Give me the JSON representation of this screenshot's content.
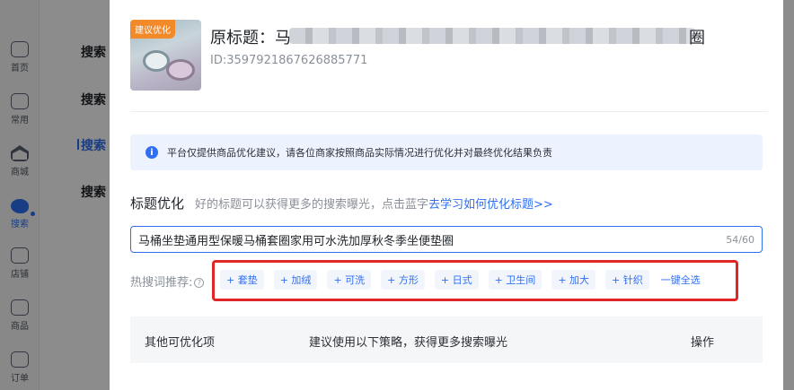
{
  "sidebar": {
    "items": [
      {
        "label": "首页",
        "icon": "home-icon"
      },
      {
        "label": "常用",
        "icon": "star-icon"
      },
      {
        "label": "商城",
        "icon": "shop-icon"
      },
      {
        "label": "搜索",
        "icon": "search-icon",
        "active": true
      },
      {
        "label": "店铺",
        "icon": "store-icon"
      },
      {
        "label": "商品",
        "icon": "goods-icon"
      },
      {
        "label": "订单",
        "icon": "order-icon"
      }
    ]
  },
  "submenu": {
    "items": [
      {
        "label": "搜索"
      },
      {
        "label": "搜索"
      },
      {
        "label": "搜索",
        "active": true
      },
      {
        "label": "搜索"
      }
    ]
  },
  "drawer": {
    "badge": "建议优化",
    "original_title_prefix": "原标题：马",
    "original_title_suffix": "圈",
    "product_id": "ID:3597921867626885771",
    "notice": "平台仅提供商品优化建议，请各位商家按照商品实际情况进行优化并对最终优化结果负责",
    "section_title": "标题优化",
    "section_hint": "好的标题可以获得更多的搜索曝光，点击蓝字",
    "hint_link": "去学习如何优化标题>>",
    "title_value": "马桶坐垫通用型保暖马桶套圈家用可水洗加厚秋冬季坐便垫圈",
    "title_count": "54/60",
    "hotword_label": "热搜词推荐:",
    "hotwords": [
      "+ 套垫",
      "+ 加绒",
      "+ 可洗",
      "+ 方形",
      "+ 日式",
      "+ 卫生间",
      "+ 加大",
      "+ 针织"
    ],
    "select_all": "一键全选",
    "table": {
      "col1": "其他可优化项",
      "col2": "建议使用以下策略，获得更多搜索曝光",
      "col3": "操作"
    }
  },
  "colors": {
    "accent": "#2f6ff0",
    "highlight_border": "#e02727",
    "badge": "#f28a2a"
  }
}
